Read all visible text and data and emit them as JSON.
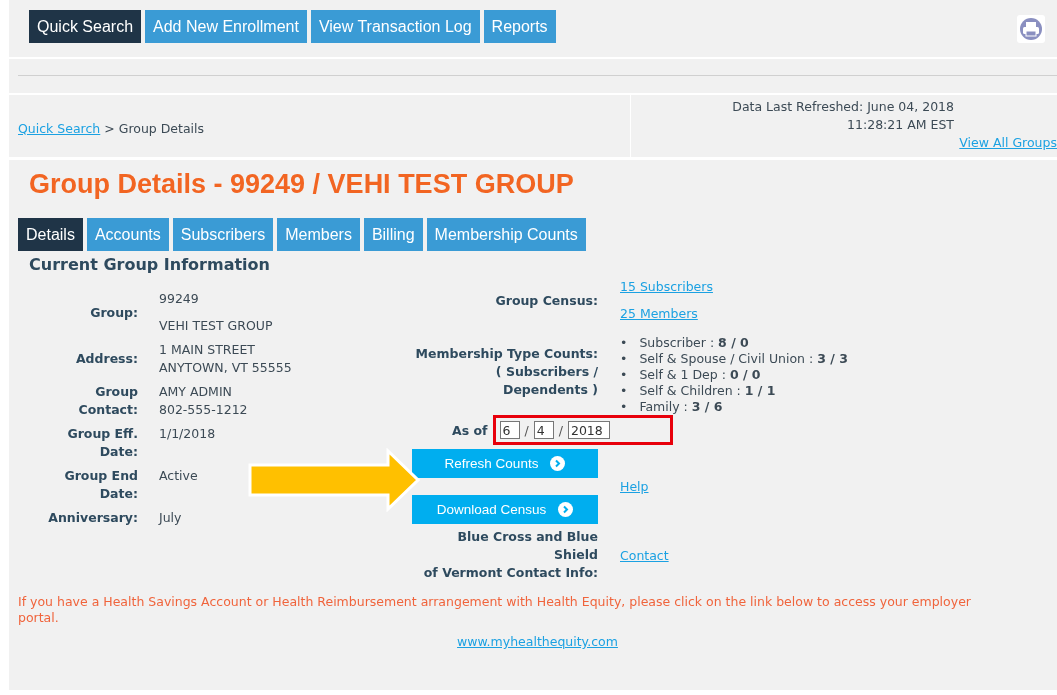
{
  "nav_buttons": [
    {
      "label": "Quick Search",
      "selected": true
    },
    {
      "label": "Add New Enrollment",
      "selected": false
    },
    {
      "label": "View Transaction Log",
      "selected": false
    },
    {
      "label": "Reports",
      "selected": false
    }
  ],
  "breadcrumb": {
    "link": "Quick Search",
    "current": "> Group Details"
  },
  "refresh_info": {
    "label": "Data Last Refreshed: June 04, 2018",
    "time": "11:28:21 AM EST",
    "link": "View All Groups"
  },
  "title": "Group Details - 99249 / VEHI TEST GROUP",
  "tabs": [
    {
      "label": "Details",
      "selected": true
    },
    {
      "label": "Accounts",
      "selected": false
    },
    {
      "label": "Subscribers",
      "selected": false
    },
    {
      "label": "Members",
      "selected": false
    },
    {
      "label": "Billing",
      "selected": false
    },
    {
      "label": "Membership Counts",
      "selected": false
    }
  ],
  "section_title": "Current Group Information",
  "group_info": [
    {
      "label": "Group:",
      "values": [
        "99249",
        "VEHI TEST GROUP"
      ]
    },
    {
      "label": "Address:",
      "values": [
        "1 MAIN STREET",
        "ANYTOWN, VT 55555"
      ]
    },
    {
      "label": "Group Contact:",
      "values": [
        "AMY ADMIN",
        "802-555-1212"
      ]
    },
    {
      "label": "Group Eff. Date:",
      "values": [
        "1/1/2018"
      ]
    },
    {
      "label": "Group End Date:",
      "values": [
        "Active"
      ]
    },
    {
      "label": "Anniversary:",
      "values": [
        "July"
      ]
    }
  ],
  "census": {
    "label": "Group Census:",
    "links": [
      "15 Subscribers",
      "25 Members"
    ]
  },
  "membership": {
    "label": "Membership Type Counts:",
    "sublabel": "( Subscribers / Dependents )",
    "items": [
      {
        "bullet": "•",
        "name": "Subscriber :",
        "counts": "8 / 0"
      },
      {
        "bullet": "•",
        "name": "Self & Spouse / Civil Union :",
        "counts": "3 / 3"
      },
      {
        "bullet": "•",
        "name": "Self & 1 Dep :",
        "counts": "0 / 0"
      },
      {
        "bullet": "•",
        "name": "Self & Children :",
        "counts": "1 / 1"
      },
      {
        "bullet": "•",
        "name": "Family :",
        "counts": "3 / 6"
      }
    ]
  },
  "as_of": {
    "label": "As of",
    "fields": [
      "6",
      "4",
      "2018"
    ],
    "separators": [
      "/",
      "/"
    ]
  },
  "buttons": [
    {
      "label": "Refresh Counts"
    },
    {
      "label": "Download Census"
    }
  ],
  "help_link": "Help",
  "contact": {
    "label_lines": [
      "Blue Cross and Blue Shield",
      "of Vermont Contact Info:"
    ],
    "link": "Contact"
  },
  "notice": "If you have a Health Savings Account or Health Reimbursement arrangement with Health Equity, please click on the link below to access your employer portal.",
  "footer_link": "www.myhealthequity.com"
}
